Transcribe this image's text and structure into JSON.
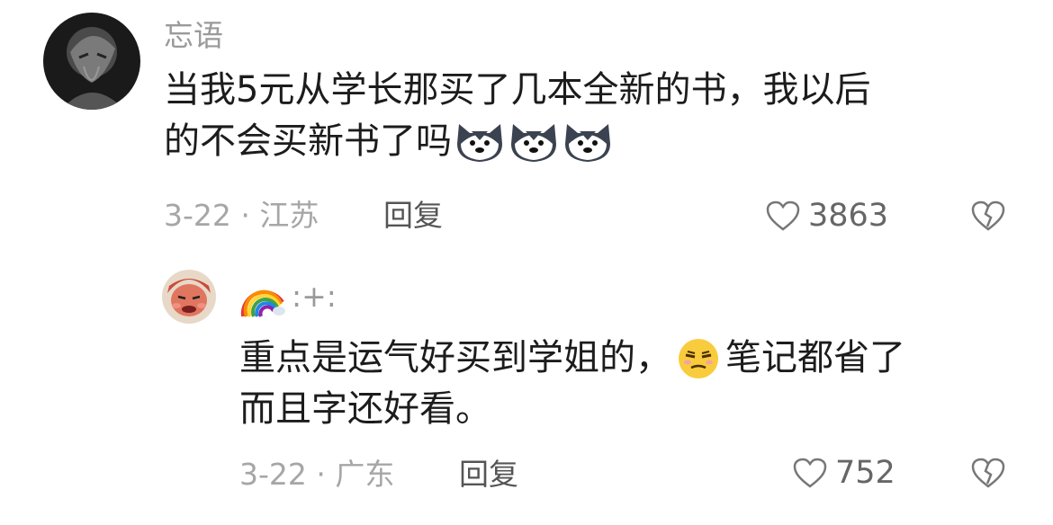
{
  "comments": [
    {
      "username": "忘语",
      "lines": [
        "当我5元从学长那买了几本全新的书，我以后",
        "的不会买新书了吗"
      ],
      "emojis": [
        "husky-emoji",
        "husky-emoji",
        "husky-emoji"
      ],
      "meta": "3-22 · 江苏",
      "reply_label": "回复",
      "likes": "3863"
    },
    {
      "username_emoji": "rainbow-emoji",
      "username": ":+:",
      "line1_a": "重点是运气好买到学姐的，",
      "line1_emoji": "smirk-face-emoji",
      "line1_b": "笔记都省了",
      "line2": "而且字还好看。",
      "meta": "3-22 · 广东",
      "reply_label": "回复",
      "likes": "752"
    }
  ],
  "colors": {
    "meta_gray": "#a6a6a6",
    "text": "#1c1c1c",
    "username": "#9a9a9a"
  }
}
